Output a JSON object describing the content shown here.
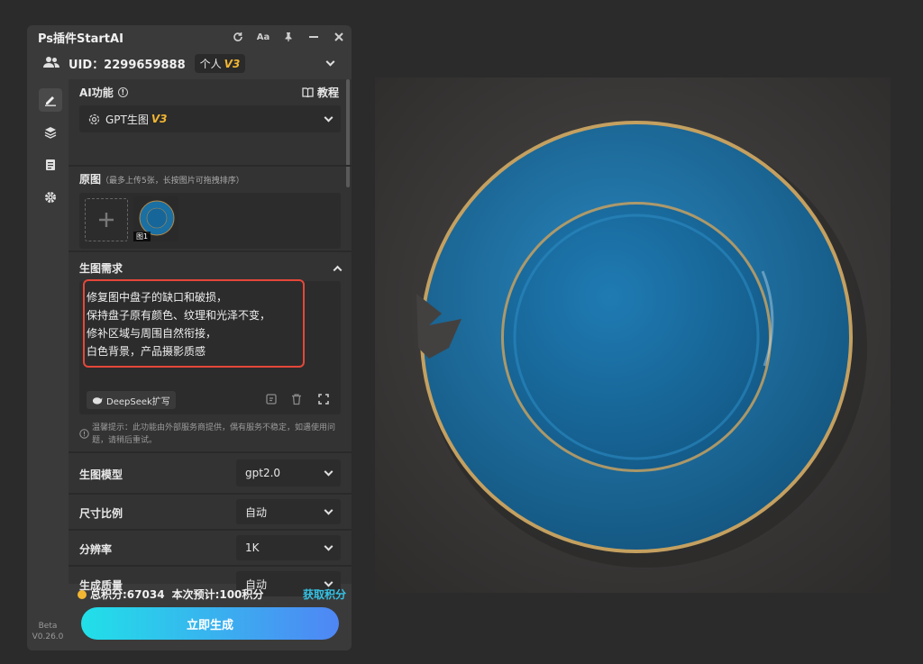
{
  "app": {
    "title": "Ps插件StartAI"
  },
  "user": {
    "uid": "UID：2299659888",
    "plan": "个人",
    "tier": "V3"
  },
  "ai_function": {
    "label": "AI功能",
    "tutorial": "教程",
    "model_name": "GPT生图",
    "model_tier": "V3"
  },
  "source": {
    "label": "原图",
    "hint": "（最多上传5张，长按图片可拖拽排序）",
    "thumb_label": "图1"
  },
  "prompt": {
    "label": "生图需求",
    "lines": [
      "修复图中盘子的缺口和破损，",
      "保持盘子原有颜色、纹理和光泽不变，",
      "修补区域与周围自然衔接，",
      "白色背景，产品摄影质感"
    ],
    "deepseek": "DeepSeek扩写"
  },
  "tip": "温馨提示：此功能由外部服务商提供，偶有服务不稳定，如遇使用问题，请稍后重试。",
  "settings": [
    {
      "label": "生图模型",
      "value": "gpt2.0"
    },
    {
      "label": "尺寸比例",
      "value": "自动"
    },
    {
      "label": "分辨率",
      "value": "1K"
    },
    {
      "label": "生成质量",
      "value": "自动"
    }
  ],
  "footer": {
    "points": "总积分:67034",
    "estimate": "本次预计:100积分",
    "get_points": "获取积分",
    "generate": "立即生成"
  },
  "version": {
    "stage": "Beta",
    "number": "V0.26.0"
  },
  "colors": {
    "accent_gold": "#f2b632",
    "highlight_red": "#e5473a",
    "link_blue": "#34c3e6",
    "plate_blue": "#1a6fa3"
  }
}
